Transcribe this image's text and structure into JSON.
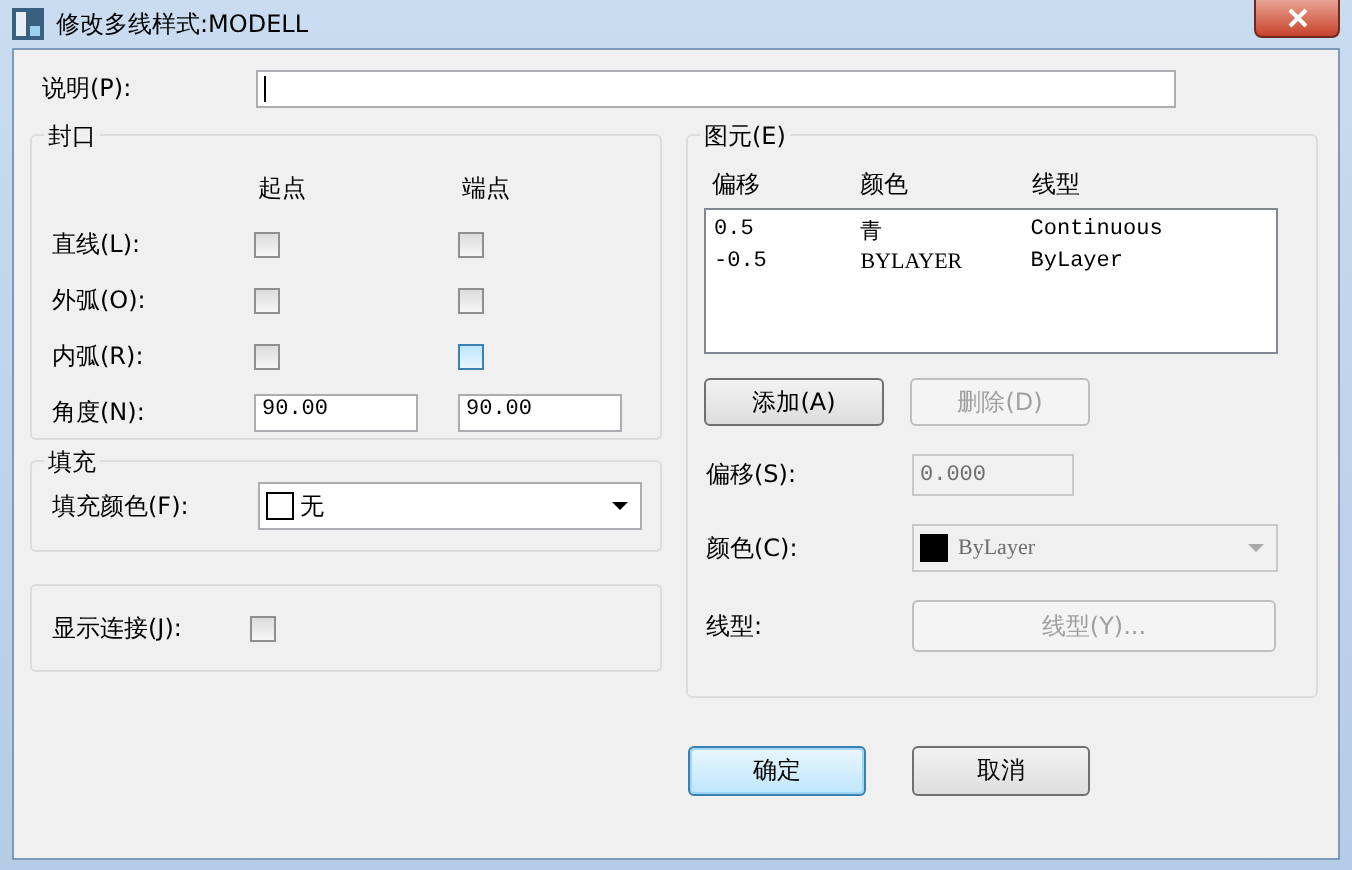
{
  "window": {
    "title": "修改多线样式:MODELL"
  },
  "description": {
    "label": "说明(P):"
  },
  "caps": {
    "title": "封口",
    "columns": [
      "起点",
      "端点"
    ],
    "rows": [
      {
        "label": "直线(L):",
        "start": {
          "checked": false,
          "highlighted": false
        },
        "end": {
          "checked": false,
          "highlighted": false
        }
      },
      {
        "label": "外弧(O):",
        "start": {
          "checked": false,
          "highlighted": false
        },
        "end": {
          "checked": false,
          "highlighted": false
        }
      },
      {
        "label": "内弧(R):",
        "start": {
          "checked": false,
          "highlighted": false
        },
        "end": {
          "checked": false,
          "highlighted": true
        }
      }
    ],
    "angle": {
      "label": "角度(N):",
      "start": "90.00",
      "end": "90.00"
    }
  },
  "fill": {
    "title": "填充",
    "label": "填充颜色(F):",
    "value": "无"
  },
  "show_joints": {
    "label": "显示连接(J):",
    "checked": false
  },
  "elements": {
    "title": "图元(E)",
    "columns": [
      "偏移",
      "颜色",
      "线型"
    ],
    "rows": [
      [
        "0.5",
        "青",
        "Continuous"
      ],
      [
        "-0.5",
        "BYLAYER",
        "ByLayer"
      ]
    ],
    "buttons": [
      {
        "label": "添加(A)",
        "disabled": false
      },
      {
        "label": "删除(D)",
        "disabled": true
      }
    ],
    "offset": {
      "label": "偏移(S):",
      "value": "0.000",
      "disabled": true
    },
    "color": {
      "label": "颜色(C):",
      "value": "ByLayer",
      "disabled": true
    },
    "linetype": {
      "label": "线型:",
      "button": "线型(Y)...",
      "disabled": true
    }
  },
  "buttons": [
    {
      "label": "确定",
      "default": true
    },
    {
      "label": "取消",
      "default": false
    }
  ]
}
